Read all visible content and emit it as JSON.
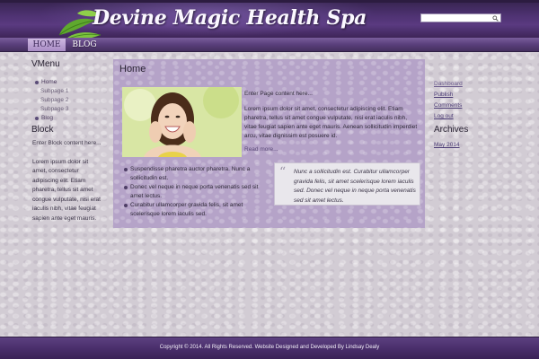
{
  "header": {
    "site_title": "Devine Magic Health Spa",
    "search": {
      "value": "",
      "placeholder": ""
    }
  },
  "nav": {
    "items": [
      {
        "label": "HOME",
        "active": true
      },
      {
        "label": "BLOG",
        "active": false
      }
    ]
  },
  "left_sidebar": {
    "vmenu_heading": "VMenu",
    "vmenu_items": [
      {
        "label": "Home",
        "level": 1
      },
      {
        "label": "Subpage 1",
        "level": 2
      },
      {
        "label": "Subpage 2",
        "level": 2
      },
      {
        "label": "Subpage 3",
        "level": 2
      },
      {
        "label": "Blog",
        "level": 1
      }
    ],
    "block_heading": "Block",
    "block_content": "Enter Block content here...",
    "block_lorem": "Lorem ipsum dolor sit amet, consectetur adipiscing elit. Etiam pharetra, tellus sit amet congue vulputate, nisi erat iaculis nibh, vitae feugiat sapien ante eget mauris."
  },
  "main": {
    "title": "Home",
    "intro": "Enter Page content here...",
    "lorem": "Lorem ipsum dolor sit amet, consectetur adipiscing elit. Etiam pharetra, tellus sit amet congue vulputate, nisi erat iaculis nibh, vitae feugiat sapien ante eget mauris. Aenean sollicitudin imperdiet arcu, vitae dignissim est posuere id.",
    "read_more": "Read more...",
    "bullets": [
      "Suspendisse pharetra auctor pharetra. Nunc a sollicitudin est.",
      "Donec vel neque in neque porta venenatis sed sit amet lectus.",
      "Curabitur ullamcorper gravida felis, sit amet scelerisque lorem iaculis sed."
    ],
    "quote": "Nunc a sollicitudin est. Curabitur ullamcorper gravida felis, sit amet scelerisque lorem iaculis sed. Donec vel neque in neque porta venenatis sed sit amet lectus."
  },
  "right_sidebar": {
    "links": [
      "Dashboard",
      "Publish",
      "Comments",
      "Log out"
    ],
    "archives_heading": "Archives",
    "archive_links": [
      "May 2014"
    ]
  },
  "footer": {
    "text": "Copyright © 2014. All Rights Reserved. Website Designed and Developed By Lindsay Dealy"
  },
  "colors": {
    "header_purple": "#4e3272",
    "content_purple": "#b5a3c8",
    "leaf_green": "#5fa82e",
    "link_purple": "#4a3a74"
  },
  "icons": [
    "leaf-logo-icon",
    "search-icon",
    "quote-icon"
  ]
}
